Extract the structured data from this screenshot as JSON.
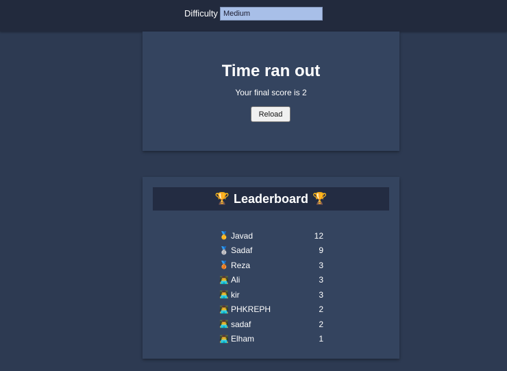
{
  "topbar": {
    "difficulty_label": "Difficulty",
    "difficulty_value": "Medium"
  },
  "game": {
    "title": "Time ran out",
    "final_score_text": "Your final score is 2",
    "reload_label": "Reload"
  },
  "leaderboard": {
    "title": "Leaderboard",
    "title_icon": "🏆",
    "rows": [
      {
        "icon": "🥇",
        "icon_name": "gold-medal-icon",
        "name": "Javad",
        "score": "12"
      },
      {
        "icon": "🥈",
        "icon_name": "silver-medal-icon",
        "name": "Sadaf",
        "score": "9"
      },
      {
        "icon": "🥉",
        "icon_name": "bronze-medal-icon",
        "name": "Reza",
        "score": "3"
      },
      {
        "icon": "👨‍💻",
        "icon_name": "technologist-icon",
        "name": "Ali",
        "score": "3"
      },
      {
        "icon": "👨‍💻",
        "icon_name": "technologist-icon",
        "name": "kir",
        "score": "3"
      },
      {
        "icon": "👨‍💻",
        "icon_name": "technologist-icon",
        "name": "PHKREPH",
        "score": "2"
      },
      {
        "icon": "👨‍💻",
        "icon_name": "technologist-icon",
        "name": "sadaf",
        "score": "2"
      },
      {
        "icon": "👨‍💻",
        "icon_name": "technologist-icon",
        "name": "Elham",
        "score": "1"
      }
    ]
  },
  "colors": {
    "page_bg": "#2d3a52",
    "topbar_bg": "#222a3d",
    "card_bg": "#34445f",
    "header_bg": "#232c42",
    "select_bg": "#a8bfe8"
  }
}
